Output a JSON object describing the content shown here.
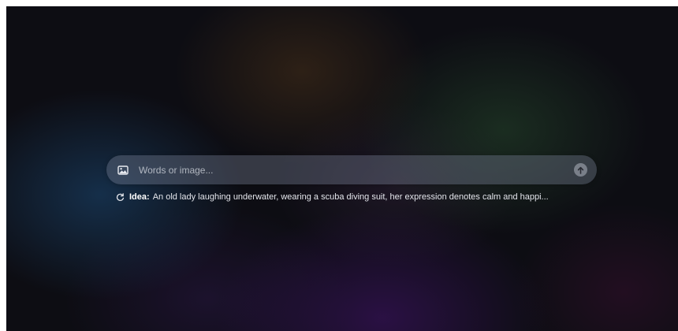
{
  "search": {
    "placeholder": "Words or image...",
    "image_icon": "image-icon",
    "submit_icon": "arrow-up-icon"
  },
  "idea": {
    "refresh_icon": "refresh-icon",
    "label": "Idea:",
    "text": "An old lady laughing underwater, wearing a scuba diving suit, her expression denotes calm and happi..."
  },
  "colors": {
    "background": "#0d0d13",
    "search_bar": "#5a6070",
    "text": "#e4e6ec"
  }
}
